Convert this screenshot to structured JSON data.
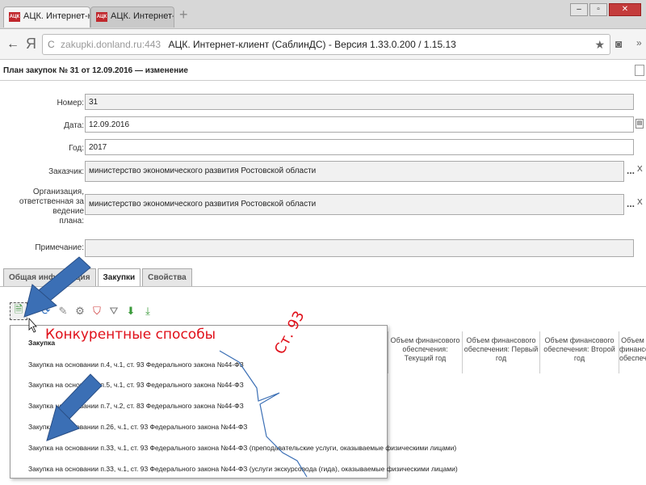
{
  "browser": {
    "tabs": [
      {
        "label": "АЦК. Интернет-клиен",
        "close": "×"
      },
      {
        "label": "АЦК. Интернет-клиен"
      }
    ],
    "new_tab": "+",
    "back": "←",
    "yandex": "Я",
    "reload": "C",
    "url_host": "zakupki.donland.ru:443",
    "page_title": "АЦК. Интернет-клиент (СаблинДС) - Версия 1.33.0.200 / 1.15.13",
    "star": "★",
    "pocket": "❤",
    "favicon_text": "АЦК"
  },
  "page": {
    "header": "План закупок № 31 от 12.09.2016 — изменение"
  },
  "form": {
    "number_label": "Номер:",
    "number_value": "31",
    "date_label": "Дата:",
    "date_value": "12.09.2016",
    "year_label": "Год:",
    "year_value": "2017",
    "customer_label": "Заказчик:",
    "customer_value": "министерство экономического развития Ростовской области",
    "org_label_1": "Организация,",
    "org_label_2": "ответственная за ведение",
    "org_label_3": "плана:",
    "org_value": "министерство экономического развития Ростовской области",
    "note_label": "Примечание:",
    "note_value": "",
    "dots": "...",
    "clear": "X"
  },
  "form_tabs": [
    "Общая информация",
    "Закупки",
    "Свойства"
  ],
  "dropdown": {
    "items": [
      "Закупка",
      "Закупка на основании п.4, ч.1, ст. 93 Федерального закона №44-ФЗ",
      "Закупка на основании п.5, ч.1, ст. 93 Федерального закона №44-ФЗ",
      "Закупка на основании п.7, ч.2, ст. 83 Федерального закона №44-ФЗ",
      "Закупка на основании п.26, ч.1, ст. 93 Федерального закона №44-ФЗ",
      "Закупка на основании п.33, ч.1, ст. 93 Федерального закона №44-ФЗ (преподавательские услуги, оказываемые физическими лицами)",
      "Закупка на основании п.33, ч.1, ст. 93 Федерального закона №44-ФЗ (услуги экскурсовода (гида), оказываемые физическими лицами)"
    ]
  },
  "grid_headers": [
    "Объем финансового обеспечения: Текущий год",
    "Объем финансового обеспечения: Первый год",
    "Объем финансового обеспечения: Второй год",
    "Объем финансового обеспечения"
  ],
  "annotations": {
    "competitive": "Конкурентные способы",
    "art93": "Ст. 93"
  },
  "colors": {
    "annotation": "#e0101a",
    "arrow": "#3b6fb5"
  }
}
